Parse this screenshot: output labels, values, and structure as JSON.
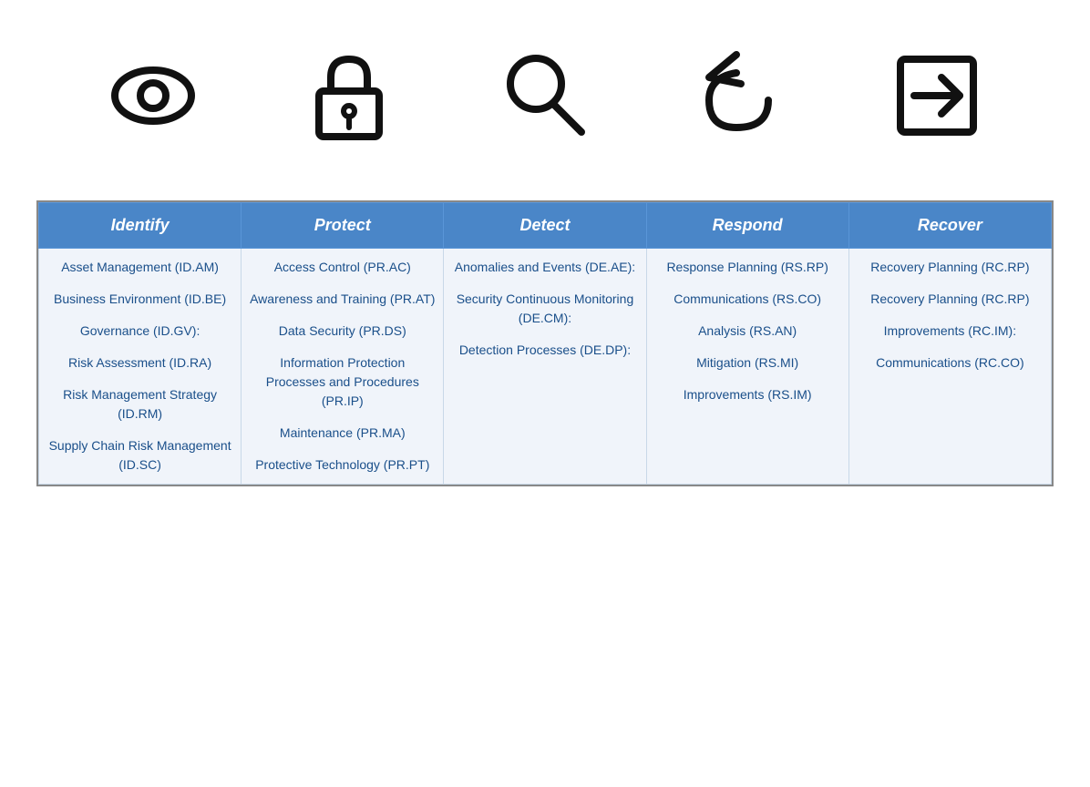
{
  "icons": [
    {
      "name": "eye-icon",
      "label": "Identify"
    },
    {
      "name": "lock-icon",
      "label": "Protect"
    },
    {
      "name": "search-icon",
      "label": "Detect"
    },
    {
      "name": "respond-icon",
      "label": "Respond"
    },
    {
      "name": "recover-icon",
      "label": "Recover"
    }
  ],
  "table": {
    "headers": [
      "Identify",
      "Protect",
      "Detect",
      "Respond",
      "Recover"
    ],
    "rows": {
      "identify": [
        "Asset Management (ID.AM)",
        "Business Environment (ID.BE)",
        "Governance (ID.GV):",
        "Risk Assessment (ID.RA)",
        "Risk Management Strategy (ID.RM)",
        "Supply Chain Risk Management (ID.SC)"
      ],
      "protect": [
        "Access Control (PR.AC)",
        "Awareness and Training (PR.AT)",
        "Data Security (PR.DS)",
        "Information Protection Processes and Procedures (PR.IP)",
        "Maintenance (PR.MA)",
        "Protective Technology (PR.PT)"
      ],
      "detect": [
        "Anomalies and Events (DE.AE):",
        "Security Continuous Monitoring (DE.CM):",
        "Detection Processes (DE.DP):"
      ],
      "respond": [
        "Response Planning (RS.RP)",
        "Communications (RS.CO)",
        "Analysis (RS.AN)",
        "Mitigation (RS.MI)",
        "Improvements (RS.IM)"
      ],
      "recover": [
        "Recovery Planning (RC.RP)",
        "Recovery Planning (RC.RP)",
        "Improvements (RC.IM):",
        "Communications (RC.CO)"
      ]
    }
  }
}
